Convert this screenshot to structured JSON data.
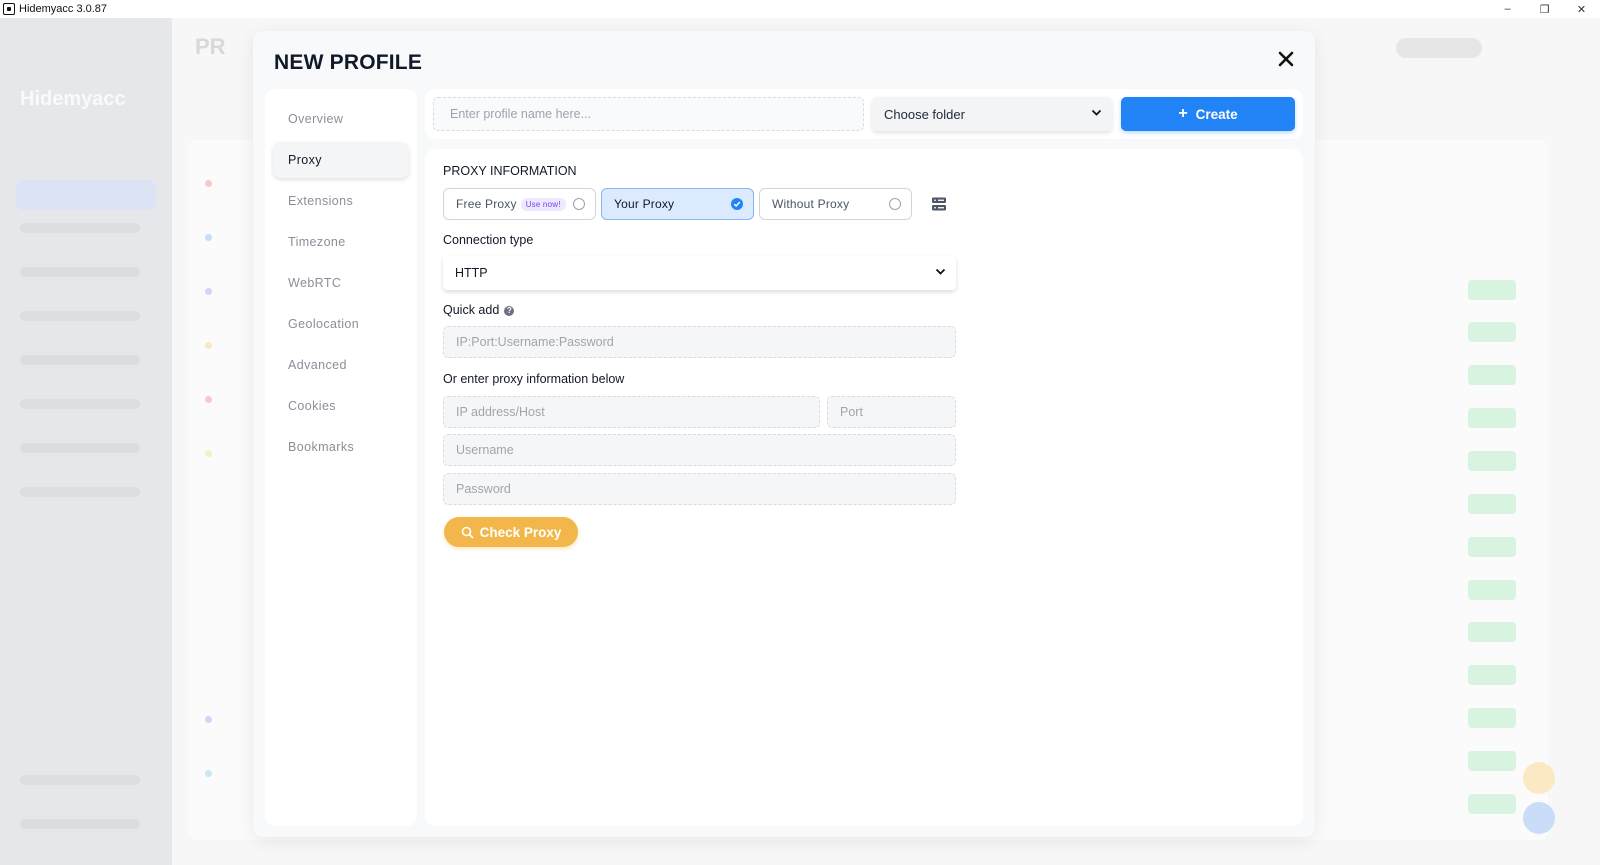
{
  "window": {
    "title": "Hidemyacc 3.0.87",
    "minimize": "–",
    "maximize": "❐",
    "close": "✕"
  },
  "background": {
    "logo": "Hidemyacc",
    "page_title": "PR"
  },
  "modal": {
    "title": "NEW PROFILE"
  },
  "sidebar": {
    "items": [
      {
        "label": "Overview"
      },
      {
        "label": "Proxy"
      },
      {
        "label": "Extensions"
      },
      {
        "label": "Timezone"
      },
      {
        "label": "WebRTC"
      },
      {
        "label": "Geolocation"
      },
      {
        "label": "Advanced"
      },
      {
        "label": "Cookies"
      },
      {
        "label": "Bookmarks"
      }
    ],
    "active": "Proxy"
  },
  "top": {
    "name_placeholder": "Enter profile name here...",
    "folder_label": "Choose folder",
    "create_label": "Create"
  },
  "proxy": {
    "section_title": "PROXY INFORMATION",
    "options": {
      "free": {
        "label": "Free Proxy",
        "badge": "Use now!"
      },
      "your": {
        "label": "Your Proxy"
      },
      "without": {
        "label": "Without Proxy"
      }
    },
    "selected": "your",
    "connection_type_label": "Connection type",
    "connection_type_value": "HTTP",
    "quick_add_label": "Quick add",
    "quick_add_placeholder": "IP:Port:Username:Password",
    "manual_label": "Or enter proxy information below",
    "host_placeholder": "IP address/Host",
    "port_placeholder": "Port",
    "username_placeholder": "Username",
    "password_placeholder": "Password",
    "check_label": "Check Proxy"
  },
  "colors": {
    "primary": "#2183f5",
    "check_button": "#f2b64a",
    "selected_option_bg": "#dbeafe"
  }
}
